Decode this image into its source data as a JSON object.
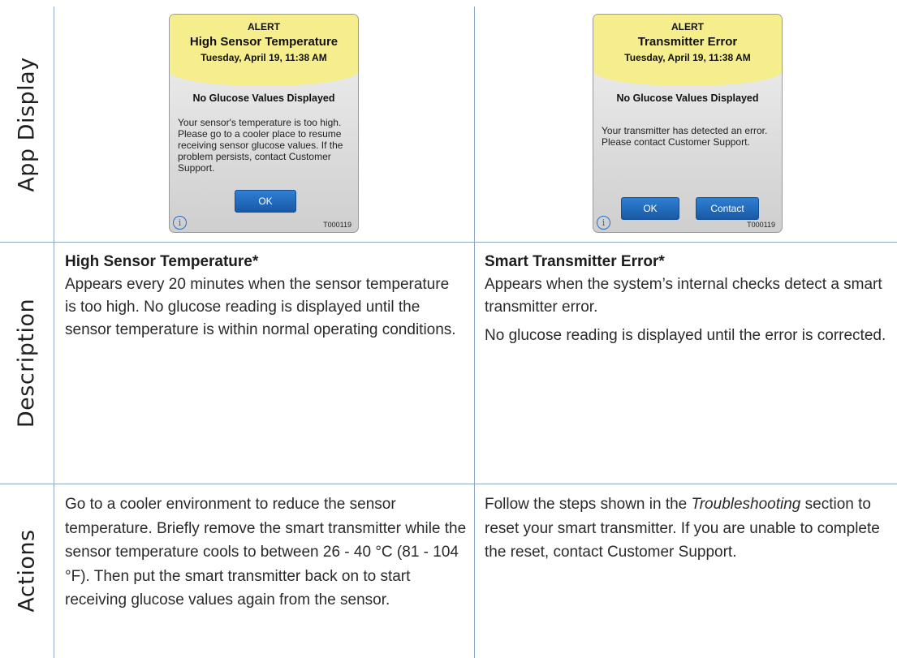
{
  "rows": {
    "app_display": "App Display",
    "description": "Description",
    "actions": "Actions"
  },
  "left": {
    "alert": {
      "kind": "ALERT",
      "title": "High Sensor Temperature",
      "datetime": "Tuesday, April 19, 11:38 AM",
      "subtitle": "No Glucose Values Displayed",
      "message": "Your sensor's temperature is too high. Please go to a cooler place to resume receiving sensor glucose values. If the problem persists, contact Customer Support.",
      "ok_label": "OK",
      "info_icon": "i",
      "code": "T000119"
    },
    "description_title": "High Sensor Temperature*",
    "description_text": "Appears every 20 minutes when the sensor temperature is too high. No glucose reading is displayed until the sensor temperature is within normal operating conditions.",
    "actions_text": "Go to a cooler environment to reduce the sensor temperature. Briefly remove the smart transmitter while the sensor temperature cools to between 26 - 40 °C (81 - 104 °F). Then put the smart transmitter back on to start receiving glucose values again from the sensor."
  },
  "right": {
    "alert": {
      "kind": "ALERT",
      "title": "Transmitter Error",
      "datetime": "Tuesday, April 19, 11:38 AM",
      "subtitle": "No Glucose Values Displayed",
      "message": "Your transmitter has detected an error. Please contact Customer Support.",
      "ok_label": "OK",
      "contact_label": "Contact",
      "info_icon": "i",
      "code": "T000119"
    },
    "description_title": "Smart Transmitter Error*",
    "description_text_1": "Appears when the system’s internal checks detect a smart transmitter error.",
    "description_text_2": "No glucose reading is displayed until the error is corrected.",
    "actions_before": "Follow the steps shown in the ",
    "actions_italic": "Troubleshooting",
    "actions_after": " section to reset your smart transmitter. If you are unable to complete the reset, contact Customer Support."
  },
  "colors": {
    "grid": "#8ea9c6",
    "alert_header": "#f6ee8c",
    "button": "#1f67b8"
  }
}
